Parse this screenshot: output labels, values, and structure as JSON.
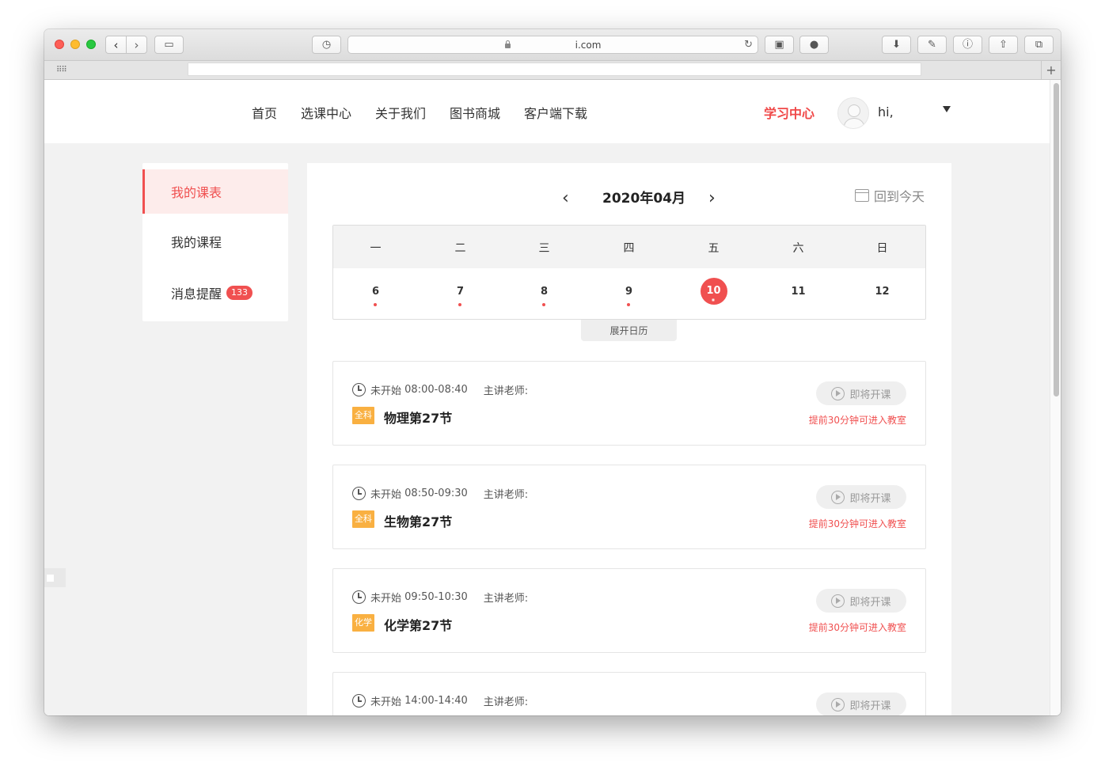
{
  "browser": {
    "address": "i.com",
    "new_tab": "+"
  },
  "header": {
    "nav": [
      "首页",
      "选课中心",
      "关于我们",
      "图书商城",
      "客户端下载"
    ],
    "study_center": "学习中心",
    "greeting": "hi,"
  },
  "sidebar": {
    "items": [
      {
        "label": "我的课表",
        "active": true
      },
      {
        "label": "我的课程",
        "active": false
      },
      {
        "label": "消息提醒",
        "active": false,
        "badge": "133"
      }
    ]
  },
  "calendar": {
    "month_title": "2020年04月",
    "back_to_today": "回到今天",
    "weekdays": [
      "一",
      "二",
      "三",
      "四",
      "五",
      "六",
      "日"
    ],
    "days": [
      {
        "num": "6",
        "has_class": true
      },
      {
        "num": "7",
        "has_class": true
      },
      {
        "num": "8",
        "has_class": true
      },
      {
        "num": "9",
        "has_class": true
      },
      {
        "num": "10",
        "has_class": true,
        "today": true
      },
      {
        "num": "11",
        "has_class": false
      },
      {
        "num": "12",
        "has_class": false
      }
    ],
    "expand_label": "展开日历"
  },
  "lessons": [
    {
      "status": "未开始",
      "time": "08:00-08:40",
      "teacher_label": "主讲老师:",
      "tag": "全科",
      "name": "物理第27节",
      "button": "即将开课",
      "hint": "提前30分钟可进入教室"
    },
    {
      "status": "未开始",
      "time": "08:50-09:30",
      "teacher_label": "主讲老师:",
      "tag": "全科",
      "name": "生物第27节",
      "button": "即将开课",
      "hint": "提前30分钟可进入教室"
    },
    {
      "status": "未开始",
      "time": "09:50-10:30",
      "teacher_label": "主讲老师:",
      "tag": "化学",
      "name": "化学第27节",
      "button": "即将开课",
      "hint": "提前30分钟可进入教室"
    },
    {
      "status": "未开始",
      "time": "14:00-14:40",
      "teacher_label": "主讲老师:",
      "tag": "",
      "name": "",
      "button": "即将开课",
      "hint": ""
    }
  ],
  "colors": {
    "accent": "#f05050",
    "tag": "#f9b041"
  }
}
